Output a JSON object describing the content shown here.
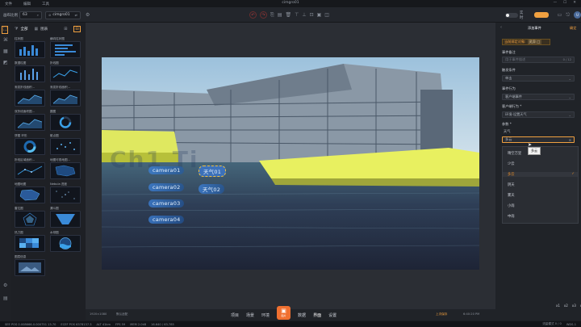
{
  "app": {
    "title": "cimgro01",
    "menu": [
      "文件",
      "编辑",
      "工具"
    ]
  },
  "toolbar": {
    "ratio_label": "画布比例",
    "ratio_value": "63",
    "project_name": "cimgro01",
    "toggle_label": "实时",
    "avatar_text": "U"
  },
  "sidebar": {
    "tabs": [
      "全部",
      "图表"
    ]
  },
  "widgets": [
    {
      "label": "柱状图",
      "thumb": "bar"
    },
    {
      "label": "横向柱状图",
      "thumb": "hbar"
    },
    {
      "label": "数据柱图",
      "thumb": "bar2"
    },
    {
      "label": "折线图",
      "thumb": "line"
    },
    {
      "label": "渐变折线面积...",
      "thumb": "area"
    },
    {
      "label": "渐变折线面积...",
      "thumb": "area"
    },
    {
      "label": "双折线面积图...",
      "thumb": "area"
    },
    {
      "label": "圆图",
      "thumb": "ring"
    },
    {
      "label": "饼图 环形",
      "thumb": "ring2"
    },
    {
      "label": "散点图",
      "thumb": "scatter"
    },
    {
      "label": "折线区域面积...",
      "thumb": "scatter2"
    },
    {
      "label": "地图可视地图...",
      "thumb": "map"
    },
    {
      "label": "地图地图",
      "thumb": "map2"
    },
    {
      "label": "Nebula 进度",
      "thumb": "stars"
    },
    {
      "label": "雷达图",
      "thumb": "radar"
    },
    {
      "label": "漏斗图",
      "thumb": "funnel"
    },
    {
      "label": "热力图",
      "thumb": "heat"
    },
    {
      "label": "水球图",
      "thumb": "water"
    },
    {
      "label": "图层信息",
      "thumb": "img"
    }
  ],
  "scene": {
    "labels": [
      {
        "text": "camera01",
        "style": "cam"
      },
      {
        "text": "天气01",
        "style": "sel"
      },
      {
        "text": "camera02",
        "style": "cam"
      },
      {
        "text": "天气02",
        "style": "cam"
      },
      {
        "text": "camera03",
        "style": "cam"
      },
      {
        "text": "camera04",
        "style": "cam"
      }
    ],
    "watermark": "Ch1 Ti"
  },
  "right_panel": {
    "title": "添加事件",
    "confirm": "确定",
    "bind_label": "当前绑定对象:",
    "bind_value": "灵异 □",
    "remark_label": "事件备注",
    "remark_placeholder": "用于事件描述",
    "remark_count": "0 / 12",
    "trigger_label": "触发条件",
    "trigger_value": "单击",
    "behavior_label": "事件行为",
    "behavior_value": "客户端事件",
    "client_label": "客户端行为 *",
    "client_value": "环境-设置天气",
    "params_label": "参数 *",
    "param_name": "天气",
    "param_value": "多云",
    "tooltip": "多云",
    "options": [
      "晴空万里",
      "少云",
      "多云",
      "阴天",
      "雾天",
      "小雨",
      "中雨"
    ],
    "selected_option": "多云"
  },
  "bottom_tabs": {
    "items": [
      "项目",
      "场景",
      "环境",
      "数据",
      "界面",
      "设置"
    ],
    "active": "界面",
    "center_label": "图片",
    "resolution": "1920×1080",
    "adapt": "默认适配",
    "save_hint": "上次保存",
    "save_time": "6:40:20 PM",
    "page_dots": [
      "x1",
      "x2",
      "x3",
      "x4"
    ]
  },
  "status": {
    "items": [
      "SEE POS 0.008666-0.000751 13.70",
      "ECEF POS 6378137.3",
      "ALT 41km",
      "FPS 59",
      "MEM 2.0kB",
      "16.640 / 63.785",
      "流量模式 0 / 0",
      "WDS-1"
    ]
  },
  "colors": {
    "accent": "#f0a040",
    "selected": "#e08a2a"
  }
}
